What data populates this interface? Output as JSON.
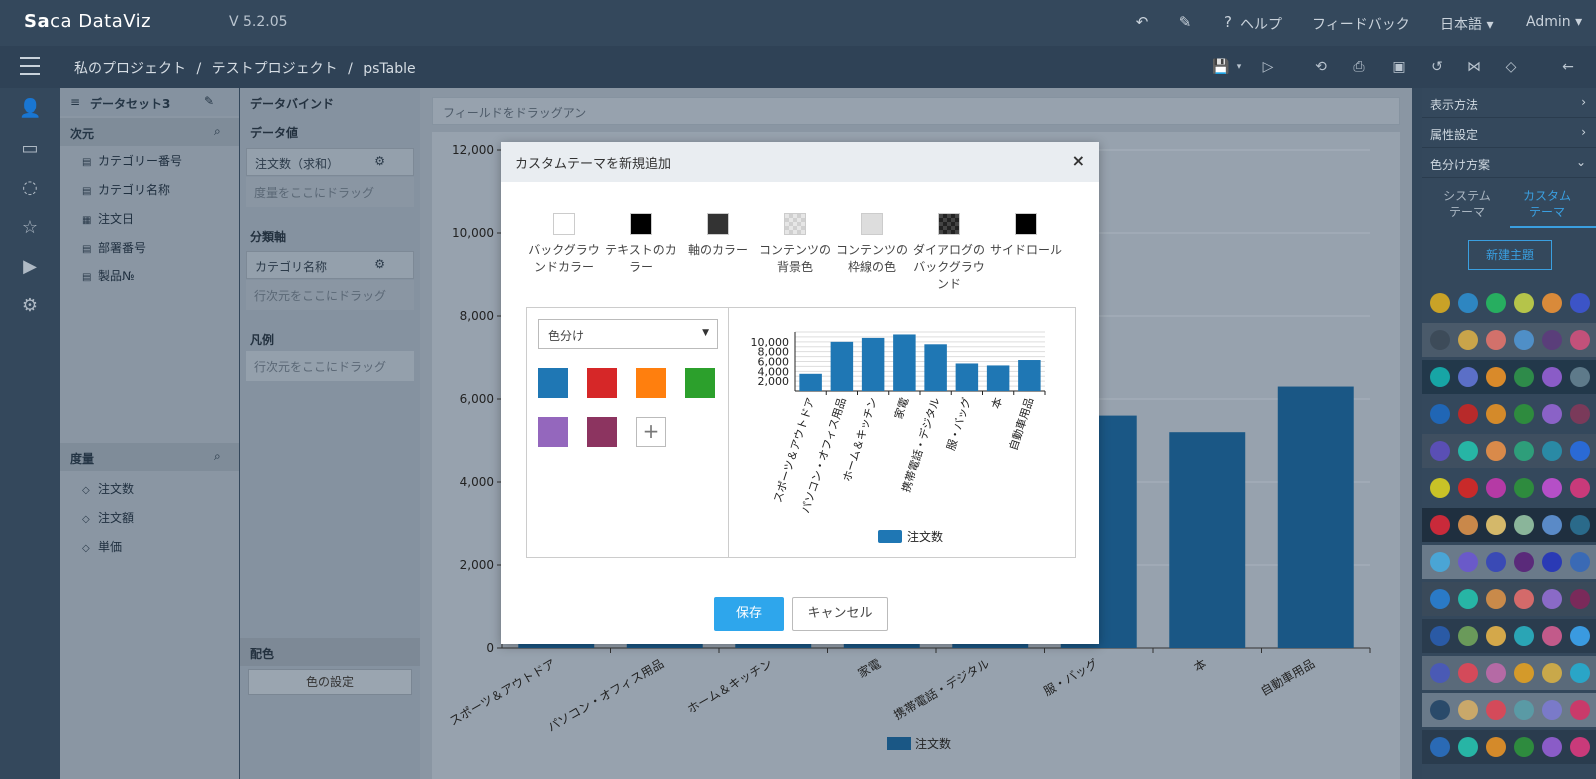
{
  "app": {
    "logo_prefix": "Sa",
    "logo_mid": "c",
    "logo_suffix": "a DataViz",
    "version": "V 5.2.05"
  },
  "topbar": {
    "help": "ヘルプ",
    "feedback": "フィードバック",
    "language": "日本語",
    "user": "Admin"
  },
  "breadcrumb": {
    "project_root": "私のプロジェクト",
    "sep1": "/",
    "project": "テストプロジェクト",
    "sep2": "/",
    "table": "psTable"
  },
  "field_panel": {
    "dataset_title": "データセット3",
    "dimension_label": "次元",
    "dimensions": [
      "カテゴリー番号",
      "カテゴリ名称",
      "注文日",
      "部署番号",
      "製品№"
    ],
    "measure_label": "度量",
    "measures": [
      "注文数",
      "注文額",
      "単価"
    ]
  },
  "bind_panel": {
    "title": "データバインド",
    "data_value_label": "データ値",
    "data_value_field": "注文数（求和）",
    "data_value_drop": "度量をここにドラッグ",
    "axis_label": "分類軸",
    "axis_field": "カテゴリ名称",
    "axis_drop": "行次元をここにドラッグ",
    "legend_label": "凡例",
    "legend_drop": "行次元をここにドラッグ",
    "color_label": "配色",
    "color_button": "色の設定"
  },
  "main": {
    "drop_hint": "フィールドをドラッグアン"
  },
  "right_panel": {
    "display_method": "表示方法",
    "attribute_settings": "属性設定",
    "color_scheme": "色分け方案",
    "tab_system_line1": "システム",
    "tab_system_line2": "テーマ",
    "tab_custom_line1": "カスタム",
    "tab_custom_line2": "テーマ",
    "new_theme_button": "新建主題",
    "palettes": [
      [
        "#c9a227",
        "#2e86c1",
        "#27ae60",
        "#b5c44a",
        "#d98a3a",
        "#3c54c7"
      ],
      [
        "#3d4b59",
        "#c9a44a",
        "#d2716b",
        "#4f8fc7",
        "#5a3e7a",
        "#c2517a"
      ],
      [
        "#17a5a5",
        "#5b6fc7",
        "#d98a2a",
        "#2e8b4a",
        "#8a5cc7",
        "#5e7a8a"
      ],
      [
        "#2066b5",
        "#b82a2a",
        "#d48a2a",
        "#2e8b3e",
        "#8a62c7",
        "#7a3a5a"
      ],
      [
        "#5a4fb5",
        "#27b5a5",
        "#d98a4a",
        "#2e9e7a",
        "#2a8aa5",
        "#2a6ad5"
      ],
      [
        "#c9c227",
        "#c92a2a",
        "#b53aa5",
        "#2e8b3e",
        "#b54fc7",
        "#c93a7a"
      ],
      [
        "#c92a3a",
        "#c9884a",
        "#d4b86a",
        "#8ab59a",
        "#5a8ac7",
        "#2a6a8a"
      ],
      [
        "#4aa5d5",
        "#6a5ac9",
        "#3a4ab5",
        "#5a2a7a",
        "#2a3ab5",
        "#3a6ab5"
      ],
      [
        "#2a7ac7",
        "#27b5a5",
        "#c98a4a",
        "#d46a6a",
        "#8a6ac7",
        "#7a2a5a"
      ],
      [
        "#2a5aa5",
        "#6a9a5a",
        "#d4a84a",
        "#2aa5b5",
        "#c25a8a",
        "#3a9ae0"
      ],
      [
        "#4a5ab5",
        "#d44a5a",
        "#b56aa5",
        "#d49a2a",
        "#c9a84a",
        "#2aa5c7"
      ],
      [
        "#2a4a6a",
        "#c9a86a",
        "#d44a5a",
        "#5a9aa5",
        "#7a7ac9",
        "#c93a6a"
      ],
      [
        "#2a6ab5",
        "#27b5a5",
        "#d48a2a",
        "#2e8b3e",
        "#8a5cc7",
        "#c93a7a"
      ]
    ]
  },
  "dialog": {
    "title": "カスタムテーマを新規追加",
    "close": "×",
    "swatches": [
      {
        "label": "バックグラウンドカラー",
        "color": "#ffffff"
      },
      {
        "label": "テキストのカラー",
        "color": "#000000"
      },
      {
        "label": "軸のカラー",
        "color": "#333333"
      },
      {
        "label": "コンテンツの背景色",
        "color": "#e6e6e6"
      },
      {
        "label": "コンテンツの枠線の色",
        "color": "#dddddd"
      },
      {
        "label": "ダイアログのバックグラウンド",
        "color": "#444444"
      },
      {
        "label": "サイドロール",
        "color": "#000000"
      }
    ],
    "select_value": "色分け",
    "color_scheme": [
      "#1f77b4",
      "#d62728",
      "#ff7f0e",
      "#2ca02c",
      "#9467bd",
      "#8c3460"
    ],
    "save": "保存",
    "cancel": "キャンセル"
  },
  "chart_data": [
    {
      "type": "bar",
      "categories": [
        "スポーツ＆アウトドア",
        "パソコン・オフィス用品",
        "ホーム＆キッチン",
        "家電",
        "携帯電話・デジタル",
        "服・バッグ",
        "本",
        "自動車用品"
      ],
      "series": [
        {
          "name": "注文数",
          "values": [
            3500,
            10000,
            10800,
            11500,
            9500,
            5600,
            5200,
            6300
          ]
        }
      ],
      "ylim": [
        0,
        12000
      ],
      "yticks": [
        "0",
        "2,000",
        "4,000",
        "6,000",
        "8,000",
        "10,000",
        "12,000"
      ],
      "legend": "bottom",
      "color": "#1a5785"
    },
    {
      "type": "bar",
      "categories": [
        "スポーツ＆アウトドア",
        "パソコン・オフィス用品",
        "ホーム＆キッチン",
        "家電",
        "携帯電話・デジタル",
        "服・バッグ",
        "本",
        "自動車用品"
      ],
      "series": [
        {
          "name": "注文数",
          "values": [
            3500,
            10000,
            10800,
            11500,
            9500,
            5600,
            5200,
            6300
          ]
        }
      ],
      "ylim": [
        0,
        12000
      ],
      "yticks": [
        "2,000",
        "4,000",
        "6,000",
        "8,000",
        "10,000"
      ],
      "legend": "bottom",
      "color": "#1f77b4"
    }
  ]
}
